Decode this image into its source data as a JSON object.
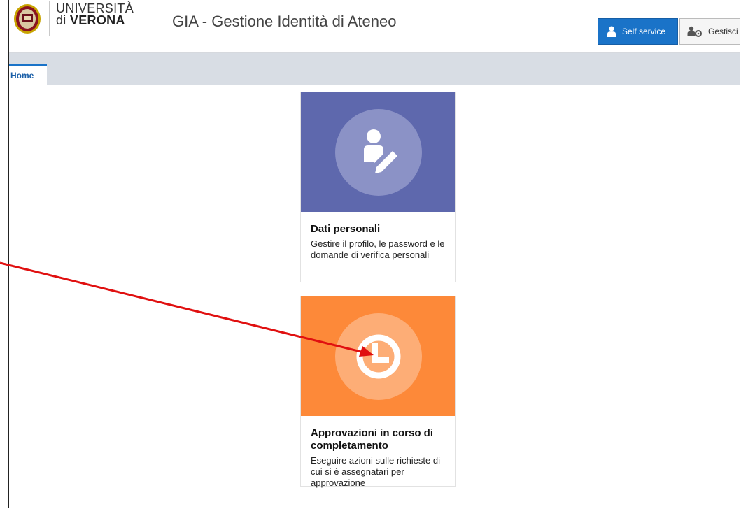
{
  "header": {
    "university_line1": "UNIVERSITÀ",
    "university_line2_prefix": "di ",
    "university_line2_name": "VERONA",
    "app_title": "GIA - Gestione Identità di Ateneo",
    "self_service_label": "Self service",
    "gestisci_label": "Gestisci"
  },
  "tabs": [
    {
      "label": "Home",
      "active": true
    }
  ],
  "cards": [
    {
      "title": "Dati personali",
      "description": "Gestire il profilo, le password e le domande di verifica personali",
      "icon": "user-edit-icon",
      "color": "#5e68ad"
    },
    {
      "title": "Approvazioni in corso di completamento",
      "description": "Eseguire azioni sulle richieste di cui si è assegnatari per approvazione",
      "icon": "clock-icon",
      "color": "#fd8939"
    }
  ],
  "colors": {
    "accent": "#1a73c8",
    "annotation_arrow": "#e01010"
  }
}
